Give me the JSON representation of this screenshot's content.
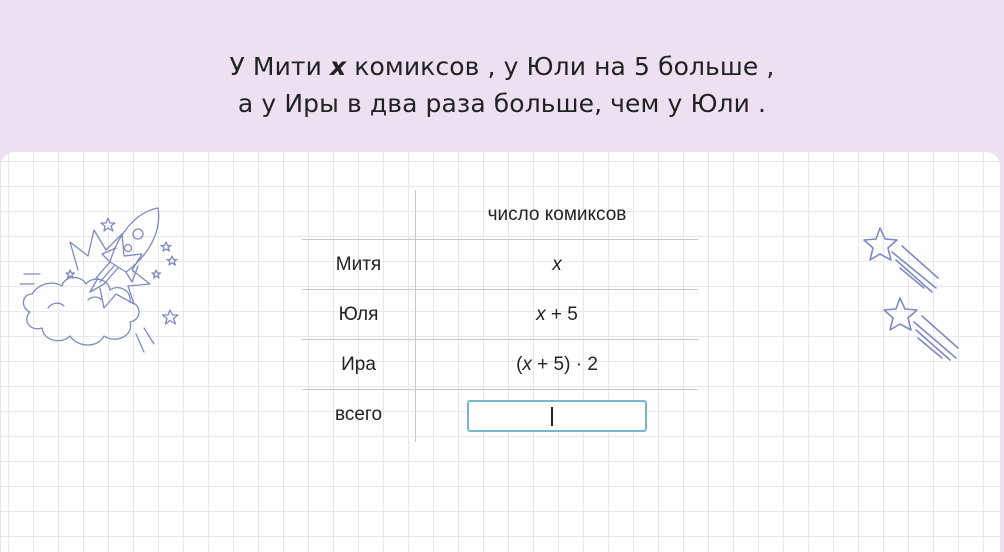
{
  "problem": {
    "line1_before": "У Мити ",
    "line1_var": "x",
    "line1_after": " комиксов ,  у Юли на 5 больше ,",
    "line2": "а у Иры в два раза больше, чем у Юли ."
  },
  "table": {
    "header": "число комиксов",
    "rows": [
      {
        "name": "Митя",
        "var": "x",
        "rest": ""
      },
      {
        "name": "Юля",
        "var": "x",
        "rest": " + 5"
      },
      {
        "name": "Ира",
        "prefix": "(",
        "var": "x",
        "rest": " + 5) · 2"
      },
      {
        "name": "всего"
      }
    ]
  },
  "answer": {
    "value": "",
    "placeholder": ""
  },
  "colors": {
    "header_bg": "#ede0f0",
    "grid_line": "#e7e7ec",
    "input_border": "#76b9cc",
    "doodle": "#7d8bbf"
  },
  "icons": {
    "left": "rocket-cloud-doodle-icon",
    "right": "shooting-stars-icon"
  }
}
